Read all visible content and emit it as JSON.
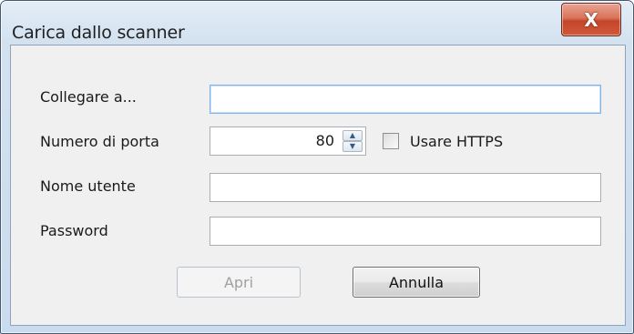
{
  "window": {
    "title": "Carica dallo scanner",
    "close_glyph": "X"
  },
  "form": {
    "connect": {
      "label": "Collegare a...",
      "value": ""
    },
    "port": {
      "label": "Numero di porta",
      "value": "80"
    },
    "https": {
      "label": "Usare HTTPS",
      "checked": false
    },
    "username": {
      "label": "Nome utente",
      "value": ""
    },
    "password": {
      "label": "Password",
      "value": ""
    }
  },
  "buttons": {
    "open_label": "Apri",
    "cancel_label": "Annulla"
  },
  "icons": {
    "close": "close-icon",
    "spin_up": "spin-up-icon",
    "spin_down": "spin-down-icon"
  },
  "colors": {
    "titlebar": "#d4e2f0",
    "close_button": "#c4452a",
    "client_bg": "#f0f0f0",
    "focus_border": "#7eb4ea"
  }
}
